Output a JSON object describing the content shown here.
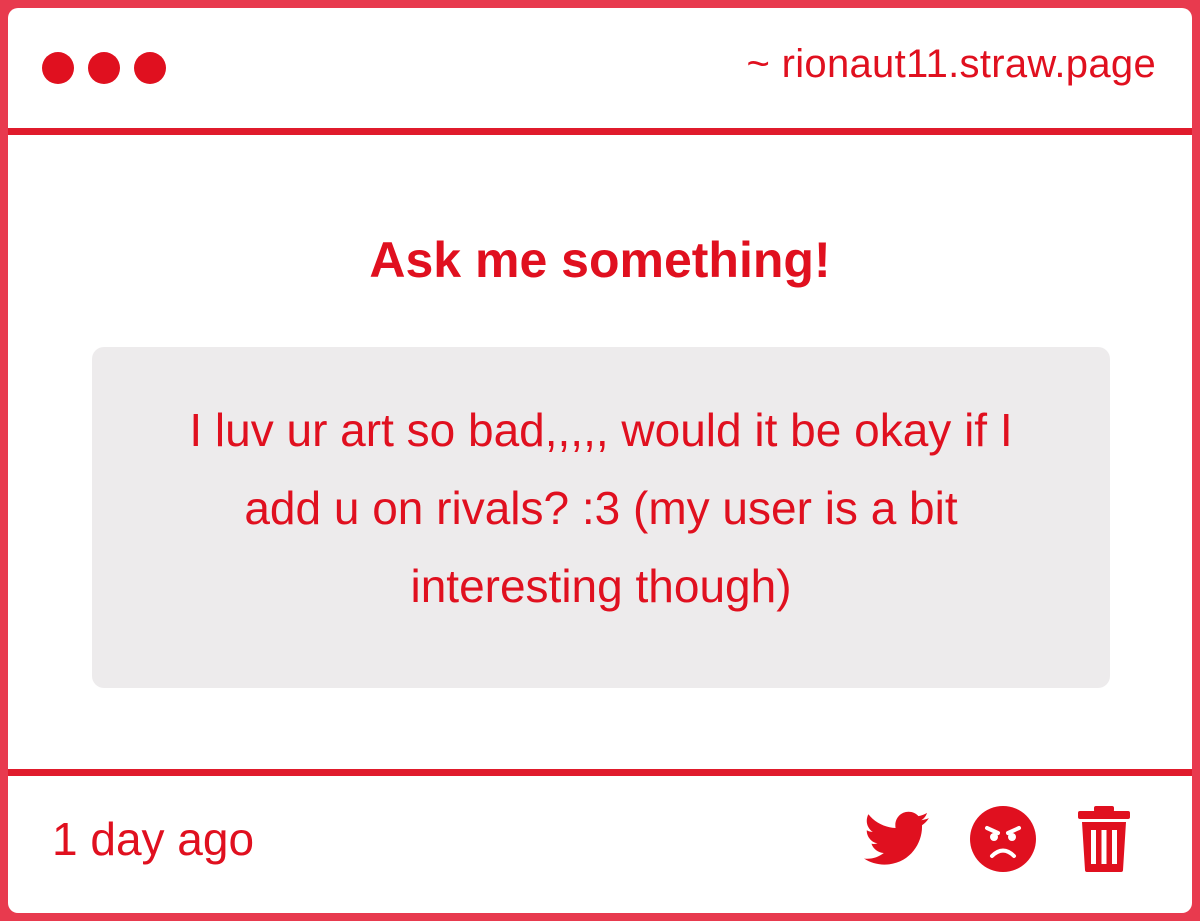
{
  "titlebar": {
    "url": "~ rionaut11.straw.page",
    "dots_icon": "window-dots"
  },
  "main": {
    "heading": "Ask me something!",
    "question": "I luv ur art so bad,,,,, would it be okay if I add u on rivals? :3 (my user is a bit interesting though)"
  },
  "footer": {
    "timestamp": "1 day ago",
    "actions": [
      {
        "icon": "twitter-icon"
      },
      {
        "icon": "angry-face-icon"
      },
      {
        "icon": "trash-icon"
      }
    ]
  },
  "colors": {
    "accent": "#e0101f",
    "frame": "#e83a4e",
    "question_bg": "#edebec",
    "background": "#ffffff"
  }
}
